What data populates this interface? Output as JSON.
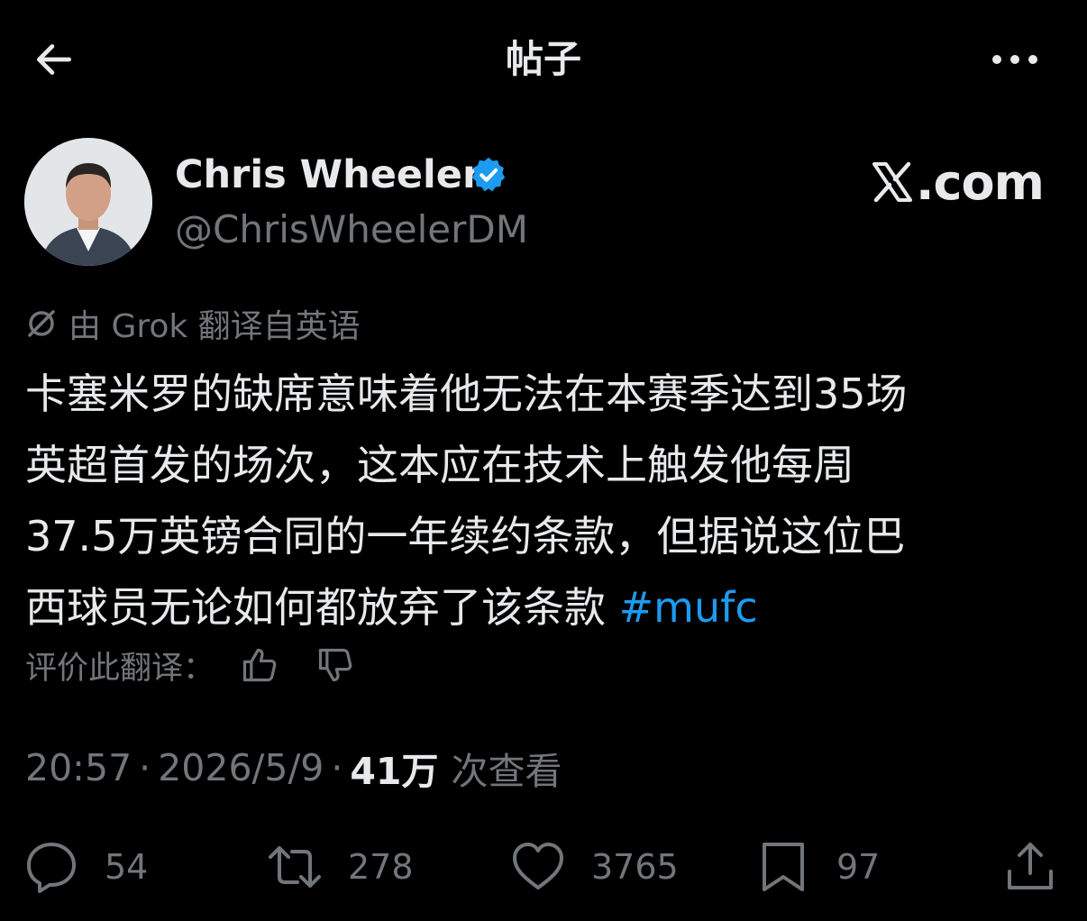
{
  "header": {
    "title": "帖子",
    "back_icon": "arrow-left-icon",
    "more_icon": "more-horizontal-icon"
  },
  "author": {
    "display_name": "Chris Wheeler",
    "handle": "@ChrisWheelerDM",
    "verified": true,
    "verified_color": "#1d9bf0"
  },
  "watermark": {
    "text": ".com"
  },
  "translation": {
    "notice": "由 Grok 翻译自英语",
    "rate_label": "评价此翻译："
  },
  "tweet": {
    "lines": [
      "卡塞米罗的缺席意味着他无法在本赛季达到35场",
      "英超首发的场次，这本应在技术上触发他每周",
      "37.5万英镑合同的一年续约条款，但据说这位巴",
      "西球员无论如何都放弃了该条款 "
    ],
    "hashtag": "#mufc",
    "hashtag_color": "#1d9bf0"
  },
  "meta": {
    "time": "20:57",
    "date": "2026/5/9",
    "separator": "·",
    "views_count": "41万",
    "views_label": "次查看"
  },
  "actions": {
    "replies": "54",
    "retweets": "278",
    "likes": "3765",
    "bookmarks": "97"
  }
}
